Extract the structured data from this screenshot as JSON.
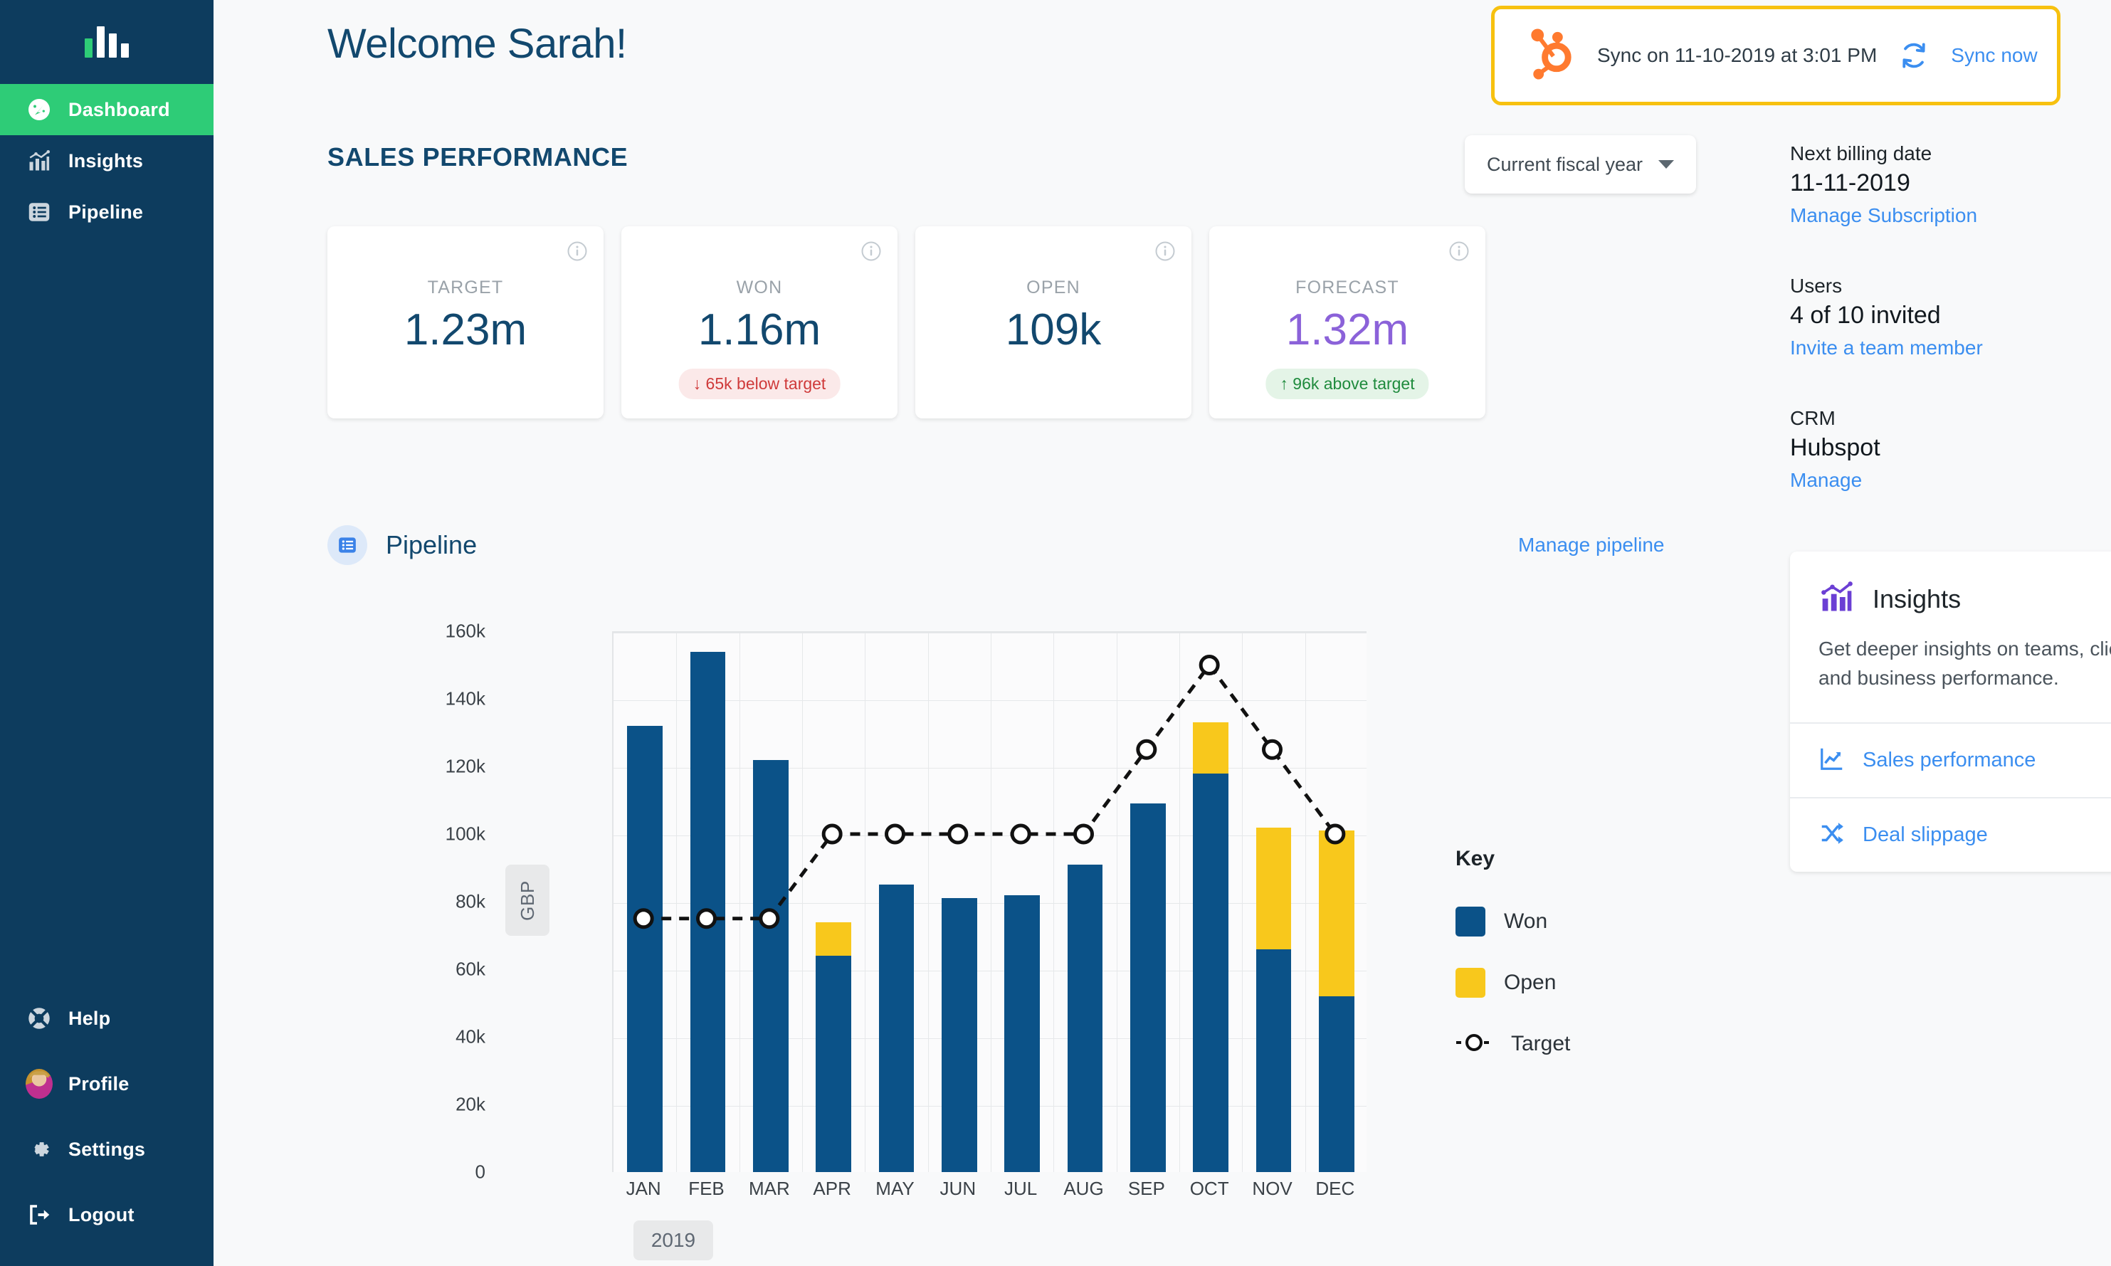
{
  "sidebar": {
    "logo_name": "bar-chart-logo",
    "top_items": [
      {
        "label": "Dashboard",
        "icon": "gauge-icon",
        "active": true
      },
      {
        "label": "Insights",
        "icon": "insights-chart-icon",
        "active": false
      },
      {
        "label": "Pipeline",
        "icon": "list-icon",
        "active": false
      }
    ],
    "bottom_items": [
      {
        "label": "Help",
        "icon": "lifebuoy-icon"
      },
      {
        "label": "Profile",
        "icon": "avatar-icon"
      },
      {
        "label": "Settings",
        "icon": "gear-icon"
      },
      {
        "label": "Logout",
        "icon": "logout-icon"
      }
    ]
  },
  "header": {
    "welcome": "Welcome Sarah!",
    "sync": {
      "logo": "hubspot-sprocket-icon",
      "text": "Sync on 11-10-2019 at 3:01 PM",
      "action_label": "Sync now",
      "refresh_icon": "refresh-icon",
      "border_color": "#f7c10f",
      "link_color": "#3b8ef0"
    }
  },
  "sales_performance": {
    "title": "SALES PERFORMANCE",
    "period_selector": "Current fiscal year",
    "cards": [
      {
        "label": "TARGET",
        "value": "1.23m",
        "badge": null,
        "badge_type": null,
        "value_color": "#12486e"
      },
      {
        "label": "WON",
        "value": "1.16m",
        "badge": "↓ 65k below target",
        "badge_type": "down",
        "value_color": "#12486e"
      },
      {
        "label": "OPEN",
        "value": "109k",
        "badge": null,
        "badge_type": null,
        "value_color": "#12486e"
      },
      {
        "label": "FORECAST",
        "value": "1.32m",
        "badge": "↑ 96k above target",
        "badge_type": "up",
        "value_color": "#8b62d9"
      }
    ]
  },
  "pipeline": {
    "icon": "list-icon",
    "title": "Pipeline",
    "manage_link": "Manage pipeline"
  },
  "chart_data": {
    "type": "bar",
    "title": "Pipeline",
    "xlabel": "2019",
    "ylabel": "GBP",
    "categories": [
      "JAN",
      "FEB",
      "MAR",
      "APR",
      "MAY",
      "JUN",
      "JUL",
      "AUG",
      "SEP",
      "OCT",
      "NOV",
      "DEC"
    ],
    "ylim": [
      0,
      160000
    ],
    "yticks": [
      0,
      20000,
      40000,
      60000,
      80000,
      100000,
      120000,
      140000,
      160000
    ],
    "ytick_labels": [
      "0",
      "20k",
      "40k",
      "60k",
      "80k",
      "100k",
      "120k",
      "140k",
      "160k"
    ],
    "grid": true,
    "legend_position": "right",
    "legend_title": "Key",
    "series": [
      {
        "name": "Won",
        "type": "bar",
        "color": "#0b5288",
        "values": [
          132000,
          154000,
          122000,
          64000,
          85000,
          81000,
          82000,
          91000,
          109000,
          118000,
          66000,
          52000
        ]
      },
      {
        "name": "Open",
        "type": "bar",
        "color": "#f8c81c",
        "values": [
          0,
          0,
          0,
          10000,
          0,
          0,
          0,
          0,
          0,
          15000,
          36000,
          49000
        ]
      },
      {
        "name": "Target",
        "type": "line",
        "color": "#111111",
        "style": "dashed-marker",
        "values": [
          75000,
          75000,
          75000,
          100000,
          100000,
          100000,
          100000,
          100000,
          125000,
          150000,
          125000,
          100000
        ]
      }
    ]
  },
  "account": {
    "billing": {
      "title": "Next billing date",
      "value": "11-11-2019",
      "link": "Manage Subscription"
    },
    "users": {
      "title": "Users",
      "value": "4 of 10 invited",
      "link": "Invite a team member"
    },
    "crm": {
      "title": "CRM",
      "value": "Hubspot",
      "link": "Manage"
    }
  },
  "insights_card": {
    "icon": "insights-chart-icon",
    "title": "Insights",
    "description": "Get deeper insights on teams, clients, and business performance.",
    "links": [
      {
        "label": "Sales performance",
        "icon": "line-chart-icon"
      },
      {
        "label": "Deal slippage",
        "icon": "shuffle-icon"
      }
    ]
  },
  "intercom": {
    "icon": "chat-bubble-icon",
    "color": "#3c49ba"
  }
}
